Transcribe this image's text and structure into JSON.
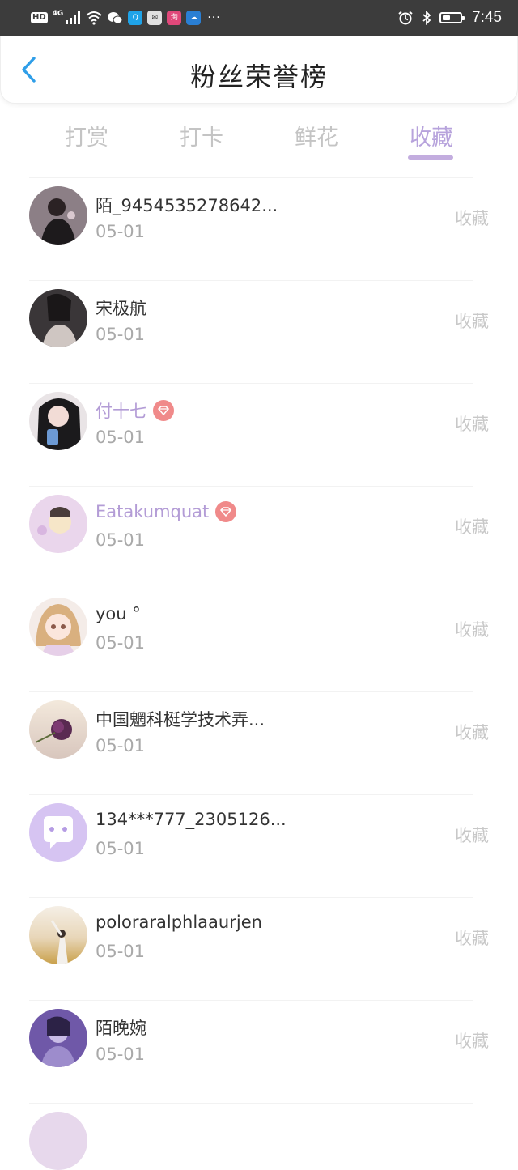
{
  "status_bar": {
    "hd": "HD",
    "network": "4G",
    "app_icons": [
      "qq-browser-icon",
      "mail-icon",
      "taobao-icon",
      "cloud-icon"
    ],
    "dots": "···",
    "time": "7:45",
    "battery_level": 0.45
  },
  "header": {
    "title": "粉丝荣誉榜",
    "back_icon": "chevron-left-icon"
  },
  "tabs": [
    {
      "label": "打赏",
      "active": false
    },
    {
      "label": "打卡",
      "active": false
    },
    {
      "label": "鲜花",
      "active": false
    },
    {
      "label": "收藏",
      "active": true
    }
  ],
  "colors": {
    "accent": "#b7a3dc",
    "vip_name": "#b39cd6",
    "vip_badge": "#f08a8a",
    "back_arrow": "#2f9ee8"
  },
  "list": [
    {
      "name": "陌_9454535278642...",
      "date": "05-01",
      "action": "收藏",
      "vip": false
    },
    {
      "name": "宋极航",
      "date": "05-01",
      "action": "收藏",
      "vip": false
    },
    {
      "name": "付十七",
      "date": "05-01",
      "action": "收藏",
      "vip": true
    },
    {
      "name": "Eatakumquat",
      "date": "05-01",
      "action": "收藏",
      "vip": true
    },
    {
      "name": "you °",
      "date": "05-01",
      "action": "收藏",
      "vip": false
    },
    {
      "name": "中国魍科梃学技术弄...",
      "date": "05-01",
      "action": "收藏",
      "vip": false
    },
    {
      "name": "134***777_2305126...",
      "date": "05-01",
      "action": "收藏",
      "vip": false
    },
    {
      "name": "poloraralphlaaurjen",
      "date": "05-01",
      "action": "收藏",
      "vip": false
    },
    {
      "name": "陌晚婉",
      "date": "05-01",
      "action": "收藏",
      "vip": false
    }
  ]
}
